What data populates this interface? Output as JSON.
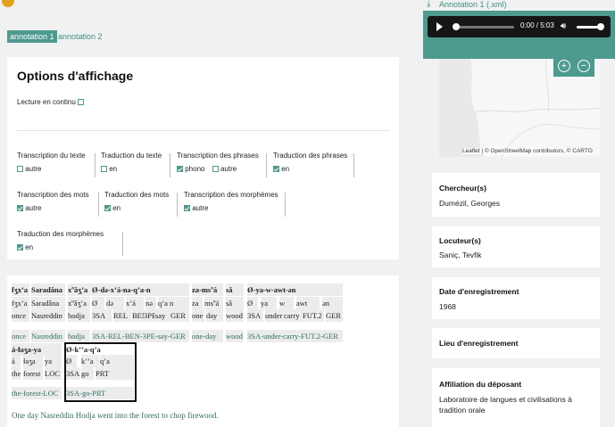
{
  "tabs": [
    {
      "label": "annotation 1",
      "active": true
    },
    {
      "label": "annotation 2",
      "active": false
    }
  ],
  "options": {
    "title": "Options d'affichage",
    "lecture": {
      "label": "Lecture en continu",
      "checked": false
    },
    "groups": [
      {
        "label": "Transcription du texte",
        "options": [
          {
            "label": "autre",
            "checked": false
          }
        ]
      },
      {
        "label": "Traduction du texte",
        "options": [
          {
            "label": "en",
            "checked": false
          }
        ]
      },
      {
        "label": "Transcription des phrases",
        "options": [
          {
            "label": "phono",
            "checked": true
          },
          {
            "label": "autre",
            "checked": false
          }
        ]
      },
      {
        "label": "Traduction des phrases",
        "options": [
          {
            "label": "en",
            "checked": true
          }
        ]
      },
      {
        "label": "Transcription des mots",
        "options": [
          {
            "label": "autre",
            "checked": true
          }
        ]
      },
      {
        "label": "Traduction des mots",
        "options": [
          {
            "label": "en",
            "checked": true
          }
        ]
      },
      {
        "label": "Transcription des morphèmes",
        "options": [
          {
            "label": "autre",
            "checked": true
          }
        ]
      },
      {
        "label": "Traduction des morphèmes",
        "options": [
          {
            "label": "en",
            "checked": true
          }
        ]
      }
    ]
  },
  "interlinear": {
    "words": [
      "fʒ̣xʼa",
      "Saradǎna",
      "xºǎʒ̣ʼa",
      "Ø-də-xʼá-nə-qʼa-n",
      "za-msºá",
      "sǎ",
      "Ø-ya-w-awt-ən"
    ],
    "morph_forms": [
      "fʒ̣xʼa",
      "Saradǎna",
      "xºǎʒ̣ʼa",
      "Ø",
      "də",
      "xʼá",
      "nə",
      "qʼa n",
      "za",
      "msºá",
      "sǎ",
      "Ø",
      "ya",
      "w",
      "awt",
      "ən"
    ],
    "morph_gloss": [
      "once",
      "Nasreddin",
      "hodja",
      "3SA",
      "REL",
      "BEN",
      "3PE",
      "say",
      "GER",
      "one",
      "day",
      "wood",
      "3SA",
      "under",
      "carry",
      "FUT.2",
      "GER"
    ],
    "word_gloss": [
      "once",
      "Nasreddin",
      "hodja",
      "3SA-REL-BEN-3PE-say-GER",
      "one-day",
      "wood",
      "3SA-under-carry-FUT.2-GER"
    ],
    "words2": [
      "á-ɫaʒ̣a-ya",
      "Ø-kʼʼa-qʼa"
    ],
    "morph_forms2": [
      "á",
      "ɫaʒ̣a",
      "ya",
      "Ø",
      "kʼʼa",
      "qʼa"
    ],
    "morph_gloss2": [
      "the",
      "forest",
      "LOC",
      "3SA",
      "go",
      "PRT"
    ],
    "word_gloss2": [
      "the-forest-LOC",
      "3SA-go-PRT"
    ],
    "free_translation": "One day Nasreddin Hodja went into the forest to chop firewood."
  },
  "download": {
    "label": "Annotation 1 (.xml)",
    "icon": "download-icon"
  },
  "player": {
    "time": "0:00 / 5:03",
    "progress": 0.0,
    "volume": 0.85
  },
  "map": {
    "attribution": "Leaflet | © OpenStreetMap contributors, © CARTO",
    "zoom_in": "+",
    "zoom_out": "−"
  },
  "metadata": [
    {
      "key": "Chercheur(s)",
      "value": "Dumézil, Georges"
    },
    {
      "key": "Locuteur(s)",
      "value": "Saniç, Tevfik"
    },
    {
      "key": "Date d'enregistrement",
      "value": "1968"
    },
    {
      "key": "Lieu d'enregistrement",
      "value": ""
    },
    {
      "key": "Affiliation du déposant",
      "value": "Laboratoire de langues et civilisations à tradition orale"
    }
  ],
  "colors": {
    "accent": "#4d9a8f",
    "player": "#161616"
  }
}
